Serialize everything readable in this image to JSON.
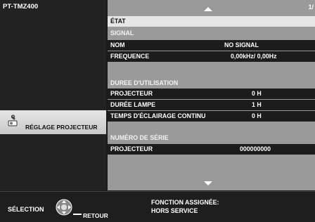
{
  "sidebar": {
    "model": "PT-TMZ400",
    "selected_item": {
      "label": "RÉGLAGE PROJECTEUR",
      "icon": "wrench-projector-icon"
    }
  },
  "main": {
    "page_indicator": "1/",
    "state_label": "ÉTAT",
    "signal_heading": "SIGNAL",
    "signal_rows": [
      {
        "label": "NOM",
        "value": "NO SIGNAL"
      },
      {
        "label": "FREQUENCE",
        "value": "0,00kHz/  0,00Hz"
      }
    ],
    "usage_heading": "DUREE D'UTILISATION",
    "usage_rows": [
      {
        "label": "PROJECTEUR",
        "value": "0  H"
      },
      {
        "label": "DURÉE LAMPE",
        "value": "1  H"
      },
      {
        "label": "TEMPS D'ÉCLAIRAGE CONTINU",
        "value": "0  H"
      }
    ],
    "serial_heading": "NUMÉRO DE SÉRIE",
    "serial_rows": [
      {
        "label": "PROJECTEUR",
        "value": "000000000"
      }
    ]
  },
  "footer": {
    "select_label": "SÉLECTION",
    "return_label": "RETOUR",
    "function_line1": "FONCTION ASSIGNÉE:",
    "function_line2": "HORS SERVICE"
  }
}
